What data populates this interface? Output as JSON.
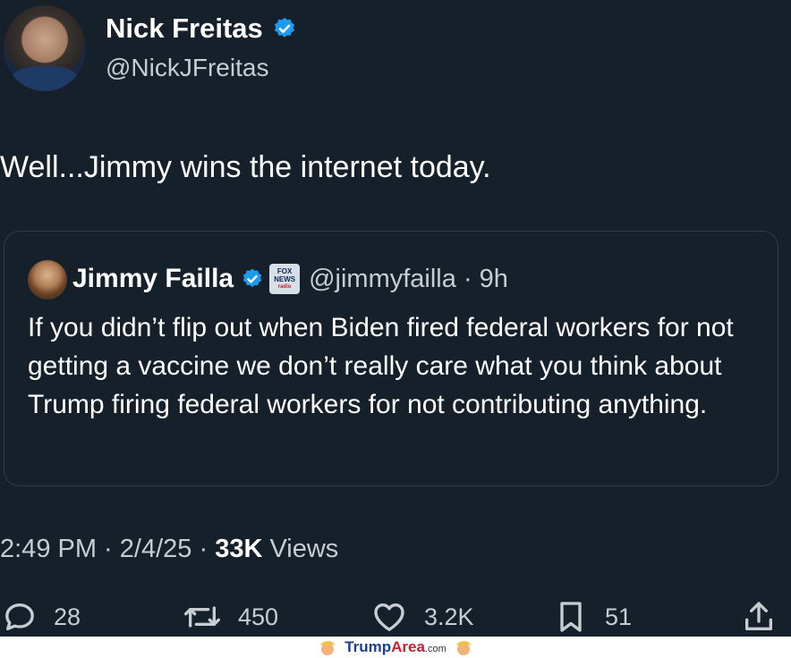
{
  "author": {
    "name": "Nick Freitas",
    "handle": "@NickJFreitas"
  },
  "tweet": {
    "text": "Well...Jimmy wins the internet today."
  },
  "quoted": {
    "name": "Jimmy Failla",
    "handle": "@jimmyfailla",
    "time": "9h",
    "affiliation_badge": [
      "FOX",
      "NEWS",
      "radio"
    ],
    "text": "If you didn’t flip out when Biden fired federal workers for not getting a vaccine we don’t really care what you think about Trump firing federal workers for not contributing anything."
  },
  "meta": {
    "time": "2:49 PM",
    "date": "2/4/25",
    "views_count": "33K",
    "views_label": "Views"
  },
  "actions": {
    "replies": "28",
    "reposts": "450",
    "likes": "3.2K",
    "bookmarks": "51"
  },
  "watermark": {
    "trump": "Trump",
    "area": "Area",
    "domain": ".com"
  },
  "colors": {
    "background": "#15202b",
    "verified": "#1d9bf0",
    "text": "#ffffff",
    "secondary": "#c8cdd2"
  },
  "icons": [
    "verified-badge-icon",
    "reply-icon",
    "repost-icon",
    "like-icon",
    "bookmark-icon",
    "share-icon"
  ]
}
